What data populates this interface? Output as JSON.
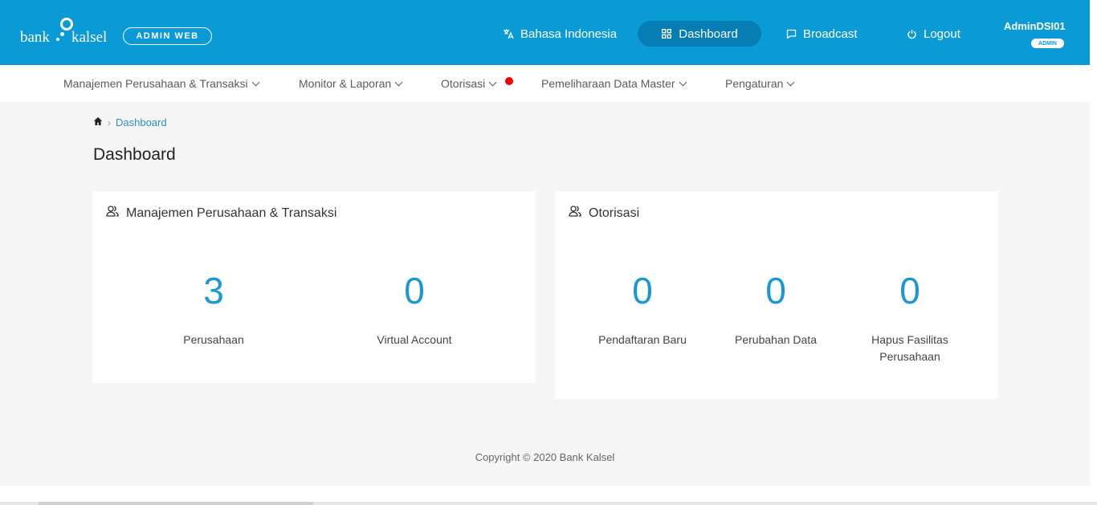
{
  "brand": {
    "logo_word_left": "bank",
    "logo_word_right": "kalsel",
    "badge": "ADMIN WEB"
  },
  "topnav": {
    "language": "Bahasa Indonesia",
    "dashboard": "Dashboard",
    "broadcast": "Broadcast",
    "logout": "Logout"
  },
  "user": {
    "name": "AdminDSI01",
    "role": "ADMIN"
  },
  "menu": [
    {
      "label": "Manajemen Perusahaan & Transaksi"
    },
    {
      "label": "Monitor & Laporan"
    },
    {
      "label": "Otorisasi",
      "notification": true
    },
    {
      "label": "Pemeliharaan Data Master"
    },
    {
      "label": "Pengaturan"
    }
  ],
  "breadcrumb": {
    "current": "Dashboard"
  },
  "page_title": "Dashboard",
  "cards": [
    {
      "title": "Manajemen Perusahaan & Transaksi",
      "stats": [
        {
          "value": "3",
          "label": "Perusahaan"
        },
        {
          "value": "0",
          "label": "Virtual Account"
        }
      ]
    },
    {
      "title": "Otorisasi",
      "stats": [
        {
          "value": "0",
          "label": "Pendaftaran Baru"
        },
        {
          "value": "0",
          "label": "Perubahan Data"
        },
        {
          "value": "0",
          "label": "Hapus Fasilitas Perusahaan"
        }
      ]
    }
  ],
  "footer": "Copyright © 2020 Bank Kalsel",
  "colors": {
    "header": "#0a9ad6",
    "active_nav": "#067db3",
    "accent_number": "#1a97d5",
    "notification": "#f00000",
    "page_bg": "#f5f5f5"
  },
  "icons": {
    "language": "translate-icon",
    "dashboard": "grid-icon",
    "broadcast": "message-icon",
    "logout": "power-icon",
    "breadcrumb_home": "home-icon",
    "card_header": "users-icon"
  }
}
